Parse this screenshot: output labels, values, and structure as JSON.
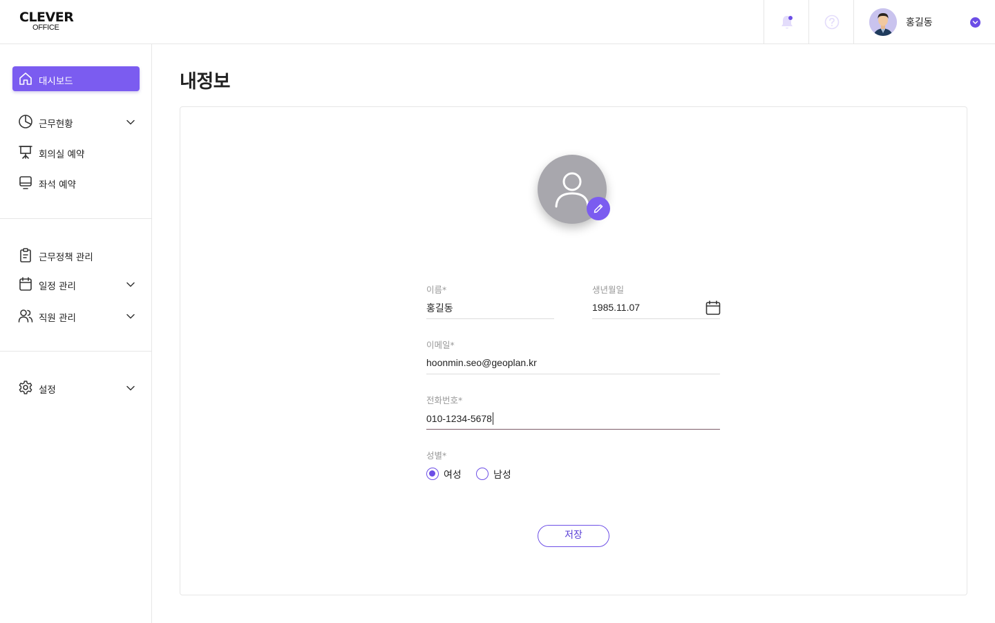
{
  "brand": {
    "logo_line1": "CLEVER",
    "logo_line2": "OFFICE",
    "accent": "#7b5cf0"
  },
  "header": {
    "notification_icon": "bell-icon",
    "help_icon": "question-circle-icon",
    "user_name": "홍길동"
  },
  "sidebar": {
    "items": [
      {
        "label": "대시보드",
        "icon": "home-icon",
        "active": true
      },
      {
        "label": "근무현황",
        "icon": "pie-chart-icon",
        "expandable": true
      },
      {
        "label": "회의실 예약",
        "icon": "presentation-board-icon"
      },
      {
        "label": "좌석 예약",
        "icon": "monitor-icon"
      },
      {
        "label": "근무정책 관리",
        "icon": "clipboard-icon"
      },
      {
        "label": "일정 관리",
        "icon": "calendar-icon",
        "expandable": true
      },
      {
        "label": "직원 관리",
        "icon": "users-icon",
        "expandable": true
      },
      {
        "label": "설정",
        "icon": "gear-icon",
        "expandable": true
      }
    ]
  },
  "main": {
    "title": "내정보",
    "form": {
      "name_label": "이름*",
      "name_value": "홍길동",
      "birth_label": "생년월일",
      "birth_value": "1985.11.07",
      "email_label": "이메일*",
      "email_value": "hoonmin.seo@geoplan.kr",
      "phone_label": "전화번호*",
      "phone_value": "010-1234-5678",
      "gender_label": "성별*",
      "gender_options": [
        "여성",
        "남성"
      ],
      "gender_selected": "여성",
      "save_label": "저장"
    }
  }
}
